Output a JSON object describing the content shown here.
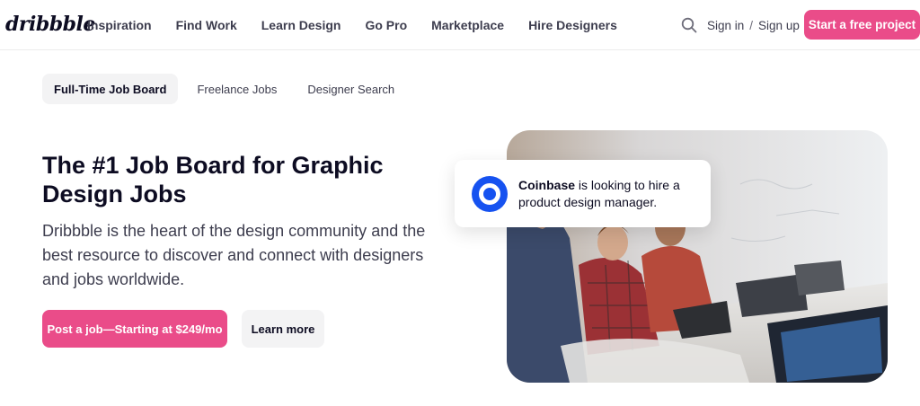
{
  "header": {
    "logo": "dribbble",
    "nav": [
      "Inspiration",
      "Find Work",
      "Learn Design",
      "Go Pro",
      "Marketplace",
      "Hire Designers"
    ],
    "sign_in": "Sign in",
    "separator": "/",
    "sign_up": "Sign up",
    "cta": "Start a free project",
    "search_icon": "search-icon"
  },
  "tabs": [
    {
      "label": "Full-Time Job Board",
      "active": true
    },
    {
      "label": "Freelance Jobs",
      "active": false
    },
    {
      "label": "Designer Search",
      "active": false
    }
  ],
  "hero": {
    "title": "The #1 Job Board for Graphic Design Jobs",
    "description": "Dribbble is the heart of the design community and the best resource to discover and connect with designers and jobs worldwide.",
    "primary_button": "Post a job—Starting at $249/mo",
    "secondary_button": "Learn more"
  },
  "card": {
    "company": "Coinbase",
    "message": " is looking to hire a product design manager.",
    "logo_icon": "coinbase-logo"
  },
  "colors": {
    "accent": "#ea4c89",
    "text": "#0d0c22",
    "muted": "#3d3d4e",
    "coinbase_blue": "#1652f0"
  }
}
